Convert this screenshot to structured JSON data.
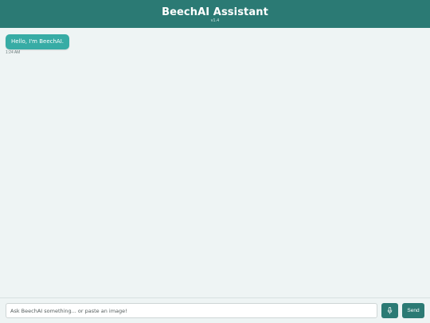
{
  "header": {
    "title": "BeechAI Assistant",
    "version": "v1.4"
  },
  "messages": [
    {
      "sender": "assistant",
      "text": "Hello, I'm BeechAI.",
      "time": "1:24 AM"
    }
  ],
  "composer": {
    "placeholder": "Ask BeechAI something... or paste an image!",
    "mic_icon": "microphone-icon",
    "send_label": "Send"
  },
  "colors": {
    "header_bg": "#2b7a74",
    "bubble_bg": "#37aca5",
    "page_bg": "#eef4f4",
    "button_bg": "#2b7a74"
  }
}
